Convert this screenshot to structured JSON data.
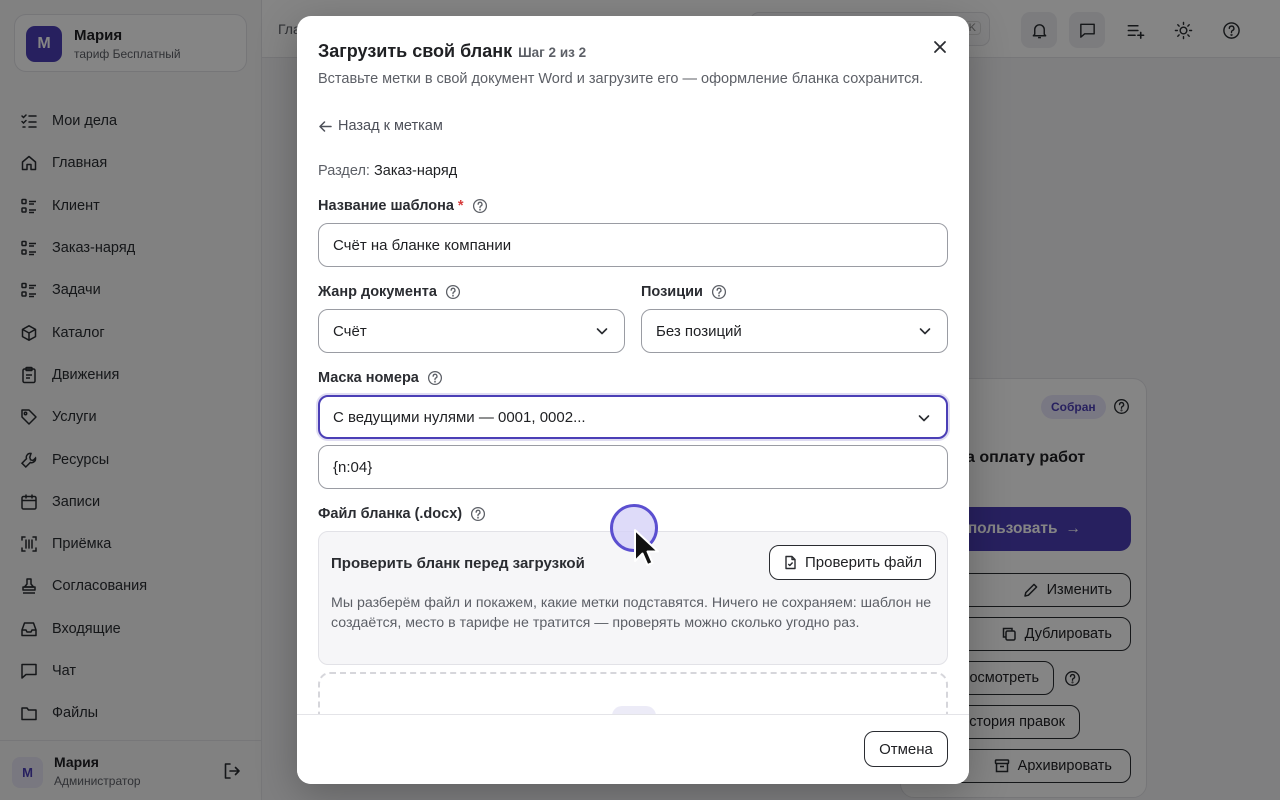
{
  "sidebar": {
    "user": {
      "initial": "М",
      "name": "Мария",
      "plan": "тариф Бесплатный"
    },
    "items": [
      {
        "label": "Мои дела",
        "icon": "checklist-icon"
      },
      {
        "label": "Главная",
        "icon": "home-icon"
      },
      {
        "label": "Клиент",
        "icon": "list-icon"
      },
      {
        "label": "Заказ-наряд",
        "icon": "list-icon"
      },
      {
        "label": "Задачи",
        "icon": "list-icon"
      },
      {
        "label": "Каталог",
        "icon": "box-icon"
      },
      {
        "label": "Движения",
        "icon": "clipboard-icon"
      },
      {
        "label": "Услуги",
        "icon": "tag-icon"
      },
      {
        "label": "Ресурсы",
        "icon": "wrench-icon"
      },
      {
        "label": "Записи",
        "icon": "calendar-icon"
      },
      {
        "label": "Приёмка",
        "icon": "scan-icon"
      },
      {
        "label": "Согласования",
        "icon": "stamp-icon"
      },
      {
        "label": "Входящие",
        "icon": "inbox-icon"
      },
      {
        "label": "Чат",
        "icon": "chat-icon"
      },
      {
        "label": "Файлы",
        "icon": "folder-icon"
      }
    ],
    "footer": {
      "initial": "М",
      "name": "Мария",
      "role": "Администратор"
    }
  },
  "topbar": {
    "breadcrumb": "Гла",
    "search_hint": "K"
  },
  "background_card": {
    "badge": "Собран",
    "title_fragment": "а оплату работ",
    "use_label": "спользовать",
    "edit_label": "Изменить",
    "duplicate_label": "Дублировать",
    "view_label": "осмотреть",
    "history_label": "стория правок",
    "archive_label": "Архивировать"
  },
  "modal": {
    "title": "Загрузить свой бланк",
    "step": "Шаг 2 из 2",
    "subtitle": "Вставьте метки в свой документ Word и загрузите его — оформление бланка сохранится.",
    "back_label": "Назад к меткам",
    "section_key": "Раздел:",
    "section_value": "Заказ-наряд",
    "template_name_label": "Название шаблона",
    "required_mark": "*",
    "template_name_value": "Счёт на бланке компании",
    "genre_label": "Жанр документа",
    "genre_value": "Счёт",
    "positions_label": "Позиции",
    "positions_value": "Без позиций",
    "mask_label": "Маска номера",
    "mask_value": "С ведущими нулями — 0001, 0002...",
    "mask_pattern": "{n:04}",
    "file_label": "Файл бланка (.docx)",
    "check_title": "Проверить бланк перед загрузкой",
    "check_button": "Проверить файл",
    "check_desc": "Мы разберём файл и покажем, какие метки подставятся. Ничего не сохраняем: шаблон не создаётся, место в тарифе не тратится — проверять можно сколько угодно раз.",
    "cancel_label": "Отмена"
  },
  "colors": {
    "accent": "#4b3fb6",
    "required": "#d63c3c"
  }
}
